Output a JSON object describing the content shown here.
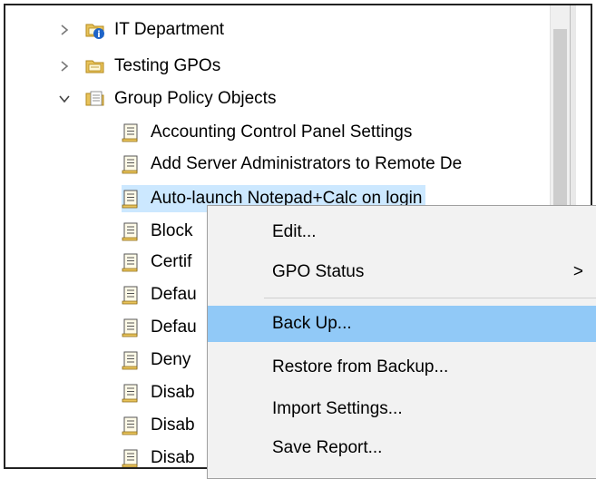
{
  "tree": {
    "nodes": [
      {
        "label": "IT Department",
        "icon": "ou-icon-with-badge",
        "expander": "collapsed"
      },
      {
        "label": "Testing GPOs",
        "icon": "ou-icon",
        "expander": "collapsed"
      },
      {
        "label": "Group Policy Objects",
        "icon": "gpo-folder-icon",
        "expander": "expanded"
      }
    ],
    "gpos": [
      "Accounting Control Panel Settings",
      "Add Server Administrators to Remote De",
      "Auto-launch Notepad+Calc on login",
      "Block",
      "Certif",
      "Defau",
      "Defau",
      "Deny",
      "Disab",
      "Disab",
      "Disab"
    ],
    "selected_gpo": "Auto-launch Notepad+Calc on login"
  },
  "context_menu": {
    "items": [
      {
        "label": "Edit..."
      },
      {
        "label": "GPO Status",
        "submenu": ">"
      },
      {
        "label": "Back Up...",
        "highlighted": true
      },
      {
        "label": "Restore from Backup..."
      },
      {
        "label": "Import Settings..."
      },
      {
        "label": "Save Report..."
      }
    ]
  },
  "colors": {
    "selection": "#cce8ff",
    "menu_highlight": "#91c9f7",
    "menu_bg": "#f2f2f2"
  }
}
